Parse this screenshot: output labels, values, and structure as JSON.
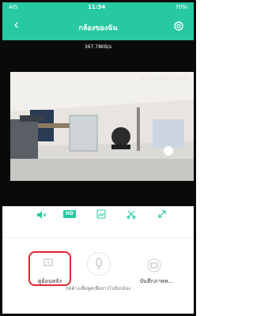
{
  "status_bar": {
    "carrier": "AIS",
    "time": "11:34",
    "battery": "70%"
  },
  "header": {
    "title": "กล้องของฉัน",
    "back_icon": "chevron-left-icon",
    "settings_icon": "gear-icon"
  },
  "stream": {
    "speed": "367.78KB/s",
    "osd": "2021-03-06 11:34:13"
  },
  "controls": {
    "items": [
      {
        "name": "mute",
        "icon": "speaker-mute-icon"
      },
      {
        "name": "quality",
        "label": "HD"
      },
      {
        "name": "screenshot",
        "icon": "image-icon"
      },
      {
        "name": "cut",
        "icon": "scissors-icon"
      },
      {
        "name": "fullscreen",
        "icon": "expand-icon"
      }
    ]
  },
  "actions": {
    "playback_label": "ดูย้อนหลัง",
    "talk_hint": "กดค้างเพื่อพูดเพื่อสารไปยังกล้อง",
    "record_label": "บันทึกภาพห..."
  },
  "colors": {
    "accent": "#28c9a2",
    "highlight": "#e0272d"
  }
}
